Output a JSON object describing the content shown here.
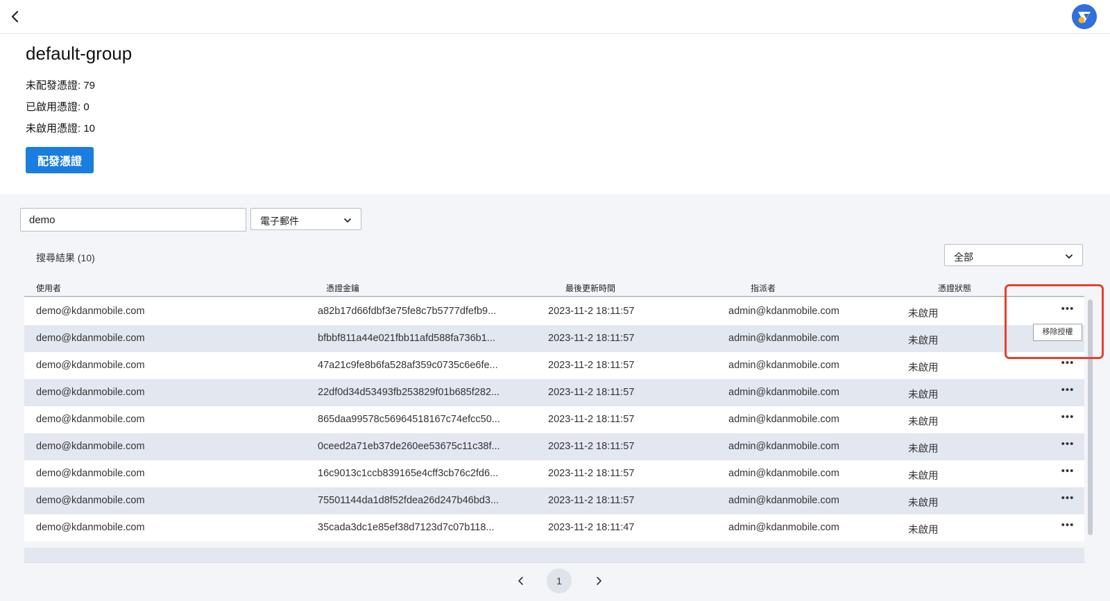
{
  "header": {
    "back_icon": "chevron-left-icon",
    "avatar_icon": "app-logo-avatar"
  },
  "group": {
    "title": "default-group",
    "unassigned": "未配發憑證: 79",
    "enabled": "已啟用憑證: 0",
    "disabled": "未啟用憑證: 10",
    "assign_button": "配發憑證"
  },
  "search": {
    "value": "demo",
    "field_select": "電子郵件",
    "status_select": "全部",
    "result_count": "搜尋結果 (10)"
  },
  "table": {
    "columns": [
      "使用者",
      "憑證金鑰",
      "最後更新時間",
      "指派者",
      "憑證狀態"
    ],
    "rows": [
      {
        "user": "demo@kdanmobile.com",
        "key": "a82b17d66fdbf3e75fe8c7b5777dfefb9...",
        "updated": "2023-11-2 18:11:57",
        "assigner": "admin@kdanmobile.com",
        "status": "未啟用"
      },
      {
        "user": "demo@kdanmobile.com",
        "key": "bfbbf811a44e021fbb11afd588fa736b1...",
        "updated": "2023-11-2 18:11:57",
        "assigner": "admin@kdanmobile.com",
        "status": "未啟用"
      },
      {
        "user": "demo@kdanmobile.com",
        "key": "47a21c9fe8b6fa528af359c0735c6e6fe...",
        "updated": "2023-11-2 18:11:57",
        "assigner": "admin@kdanmobile.com",
        "status": "未啟用"
      },
      {
        "user": "demo@kdanmobile.com",
        "key": "22df0d34d53493fb253829f01b685f282...",
        "updated": "2023-11-2 18:11:57",
        "assigner": "admin@kdanmobile.com",
        "status": "未啟用"
      },
      {
        "user": "demo@kdanmobile.com",
        "key": "865daa99578c56964518167c74efcc50...",
        "updated": "2023-11-2 18:11:57",
        "assigner": "admin@kdanmobile.com",
        "status": "未啟用"
      },
      {
        "user": "demo@kdanmobile.com",
        "key": "0ceed2a71eb37de260ee53675c11c38f...",
        "updated": "2023-11-2 18:11:57",
        "assigner": "admin@kdanmobile.com",
        "status": "未啟用"
      },
      {
        "user": "demo@kdanmobile.com",
        "key": "16c9013c1ccb839165e4cff3cb76c2fd6...",
        "updated": "2023-11-2 18:11:57",
        "assigner": "admin@kdanmobile.com",
        "status": "未啟用"
      },
      {
        "user": "demo@kdanmobile.com",
        "key": "75501144da1d8f52fdea26d247b46bd3...",
        "updated": "2023-11-2 18:11:57",
        "assigner": "admin@kdanmobile.com",
        "status": "未啟用"
      },
      {
        "user": "demo@kdanmobile.com",
        "key": "35cada3dc1e85ef38d7123d7c07b118...",
        "updated": "2023-11-2 18:11:47",
        "assigner": "admin@kdanmobile.com",
        "status": "未啟用"
      }
    ],
    "more_label": "•••",
    "row_menu_item": "移除授權"
  },
  "pagination": {
    "current_page": "1",
    "prev_icon": "chevron-left-icon",
    "next_icon": "chevron-right-icon"
  },
  "colors": {
    "primary": "#1a7de0",
    "row_alt": "#e3e7f0",
    "highlight": "#e6402a"
  }
}
